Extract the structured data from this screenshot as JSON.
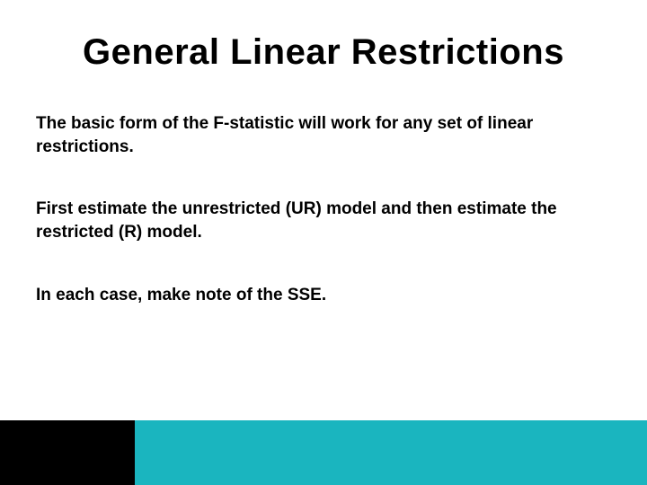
{
  "title": "General Linear Restrictions",
  "paragraphs": {
    "p1": "The basic form of the F-statistic will work for any set of linear restrictions.",
    "p2": "First estimate the unrestricted (UR) model and then estimate the restricted (R) model.",
    "p3": "In each case, make note of the SSE."
  },
  "colors": {
    "footer_left": "#000000",
    "footer_right": "#1ab5bf"
  }
}
